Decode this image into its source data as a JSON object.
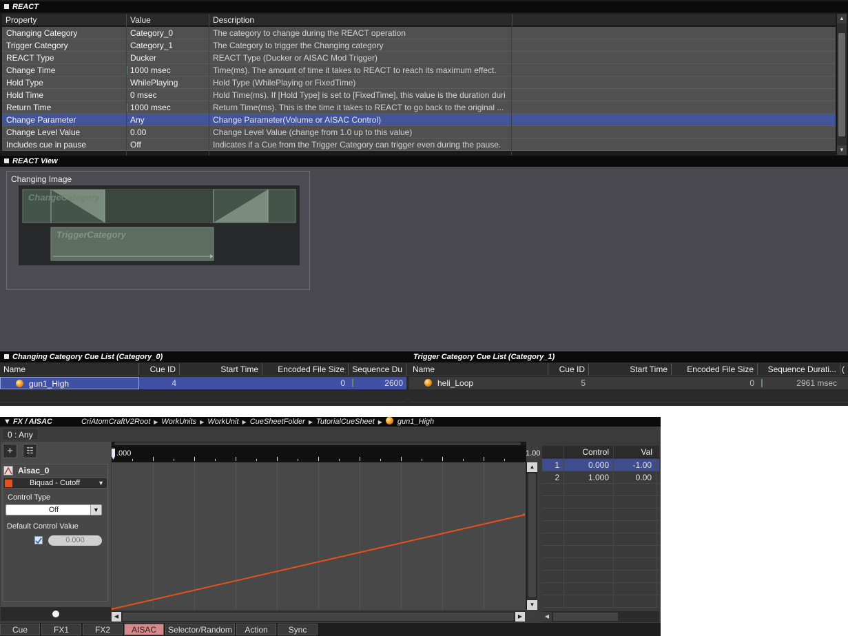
{
  "react": {
    "title": "REACT",
    "columns": {
      "property": "Property",
      "value": "Value",
      "description": "Description"
    },
    "rows": [
      {
        "property": "Changing Category",
        "value": "Category_0",
        "description": "The category to change during the REACT operation"
      },
      {
        "property": "Trigger Category",
        "value": "Category_1",
        "description": "The Category to trigger the Changing category"
      },
      {
        "property": "REACT Type",
        "value": "Ducker",
        "description": "REACT Type (Ducker or AISAC Mod Trigger)"
      },
      {
        "property": "Change Time",
        "value": "1000 msec",
        "description": "Time(ms). The amount of time it takes to REACT to reach its maximum effect."
      },
      {
        "property": "Hold Type",
        "value": "WhilePlaying",
        "description": "Hold Type (WhilePlaying or FixedTime)"
      },
      {
        "property": "Hold Time",
        "value": "0 msec",
        "description": "Hold Time(ms). If [Hold Type] is set to [FixedTime], this value is the duration duri"
      },
      {
        "property": "Return Time",
        "value": "1000 msec",
        "description": "Return Time(ms). This is the time it takes to REACT to go back to the original ..."
      },
      {
        "property": "Change Parameter",
        "value": "Any",
        "description": "Change Parameter(Volume or AISAC Control)"
      },
      {
        "property": "Change Level Value",
        "value": "0.00",
        "description": "Change Level Value (change from 1.0 up to this value)"
      },
      {
        "property": "Includes cue in pause",
        "value": "Off",
        "description": "Indicates if a Cue from the Trigger Category can trigger even during the pause."
      }
    ],
    "selected_row": 7
  },
  "react_view": {
    "title": "REACT View",
    "changing_image_label": "Changing Image",
    "change_category_label": "ChangeCategory",
    "trigger_category_label": "TriggerCategory"
  },
  "changing_list": {
    "title": "Changing Category Cue List (Category_0)",
    "columns": [
      "Name",
      "Cue ID",
      "Start Time",
      "Encoded File Size",
      "Sequence Du"
    ],
    "row": {
      "name": "gun1_High",
      "cue_id": "4",
      "start_time": "",
      "file_size": "0",
      "duration": "2600"
    }
  },
  "trigger_list": {
    "title": "Trigger Category Cue List (Category_1)",
    "columns": [
      "Name",
      "Cue ID",
      "Start Time",
      "Encoded File Size",
      "Sequence Durati...",
      "("
    ],
    "row": {
      "name": "heli_Loop",
      "cue_id": "5",
      "start_time": "",
      "file_size": "0",
      "duration": "2961 msec"
    }
  },
  "fx": {
    "title": "FX / AISAC",
    "breadcrumb": [
      "CriAtomCraftV2Root",
      "WorkUnits",
      "WorkUnit",
      "CueSheetFolder",
      "TutorialCueSheet",
      "gun1_High"
    ],
    "tab_any": "0 : Any",
    "aisac_name": "Aisac_0",
    "aisac_type": "Biquad - Cutoff",
    "control_type_label": "Control Type",
    "control_type_value": "Off",
    "default_control_label": "Default Control Value",
    "default_control_value": "0.000",
    "ruler_start": ".000",
    "ruler_end": "1.00",
    "table_columns": [
      "Control",
      "Val"
    ],
    "points": [
      {
        "index": "1",
        "control": "0.000",
        "value": "-1.00"
      },
      {
        "index": "2",
        "control": "1.000",
        "value": "0.00"
      }
    ],
    "curve_color": "#e8501a",
    "tabs": [
      "Cue",
      "FX1",
      "FX2",
      "AISAC",
      "Selector/Random",
      "Action",
      "Sync"
    ],
    "active_tab": "AISAC"
  },
  "colors": {
    "selection": "#44549a",
    "curve": "#e8501a",
    "active_tab": "#d28a8a"
  }
}
